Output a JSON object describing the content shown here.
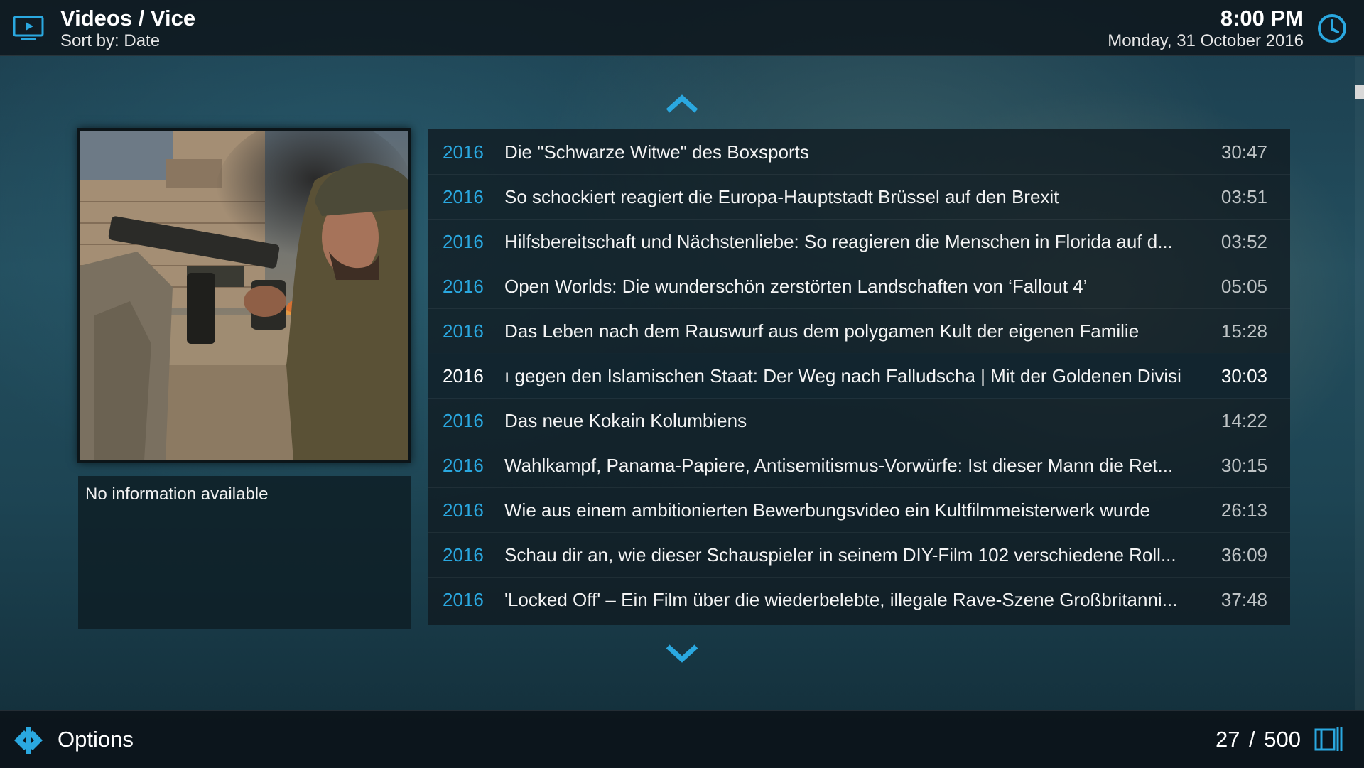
{
  "header": {
    "title": "Videos / Vice",
    "sort": "Sort by: Date",
    "time": "8:00 PM",
    "date": "Monday, 31 October 2016"
  },
  "info_panel": {
    "plot": "No information available"
  },
  "list": {
    "items": [
      {
        "year": "2016",
        "title": "Die \"Schwarze Witwe\" des Boxsports",
        "duration": "30:47"
      },
      {
        "year": "2016",
        "title": "So schockiert reagiert die Europa-Hauptstadt Brüssel auf den Brexit",
        "duration": "03:51"
      },
      {
        "year": "2016",
        "title": "Hilfsbereitschaft und Nächstenliebe: So reagieren die Menschen in Florida auf d...",
        "duration": "03:52"
      },
      {
        "year": "2016",
        "title": "Open Worlds: Die wunderschön zerstörten Landschaften von ‘Fallout 4’",
        "duration": "05:05"
      },
      {
        "year": "2016",
        "title": "Das Leben nach dem Rauswurf aus dem polygamen Kult der eigenen Familie",
        "duration": "15:28"
      },
      {
        "year": "2016",
        "title": "ı gegen den Islamischen Staat: Der Weg nach Falludscha | Mit der Goldenen Divisi",
        "duration": "30:03",
        "focused": true
      },
      {
        "year": "2016",
        "title": "Das neue Kokain Kolumbiens",
        "duration": "14:22"
      },
      {
        "year": "2016",
        "title": "Wahlkampf, Panama-Papiere, Antisemitismus-Vorwürfe: Ist dieser Mann die Ret...",
        "duration": "30:15"
      },
      {
        "year": "2016",
        "title": "Wie aus einem ambitionierten Bewerbungsvideo ein Kultfilmmeisterwerk wurde",
        "duration": "26:13"
      },
      {
        "year": "2016",
        "title": "Schau dir an, wie dieser Schauspieler in seinem DIY-Film 102 verschiedene Roll...",
        "duration": "36:09"
      },
      {
        "year": "2016",
        "title": "'Locked Off' – Ein Film über die wiederbelebte, illegale Rave-Szene Großbritanni...",
        "duration": "37:48"
      }
    ]
  },
  "footer": {
    "options_label": "Options",
    "counter": "27 / 500"
  },
  "colors": {
    "accent": "#2aa8e0",
    "header_bg": "#0e161c",
    "list_bg": "#101a20"
  },
  "icons": {
    "header": "tv-icon",
    "clock": "clock-icon",
    "options": "options-icon",
    "counter": "list-view-icon"
  }
}
